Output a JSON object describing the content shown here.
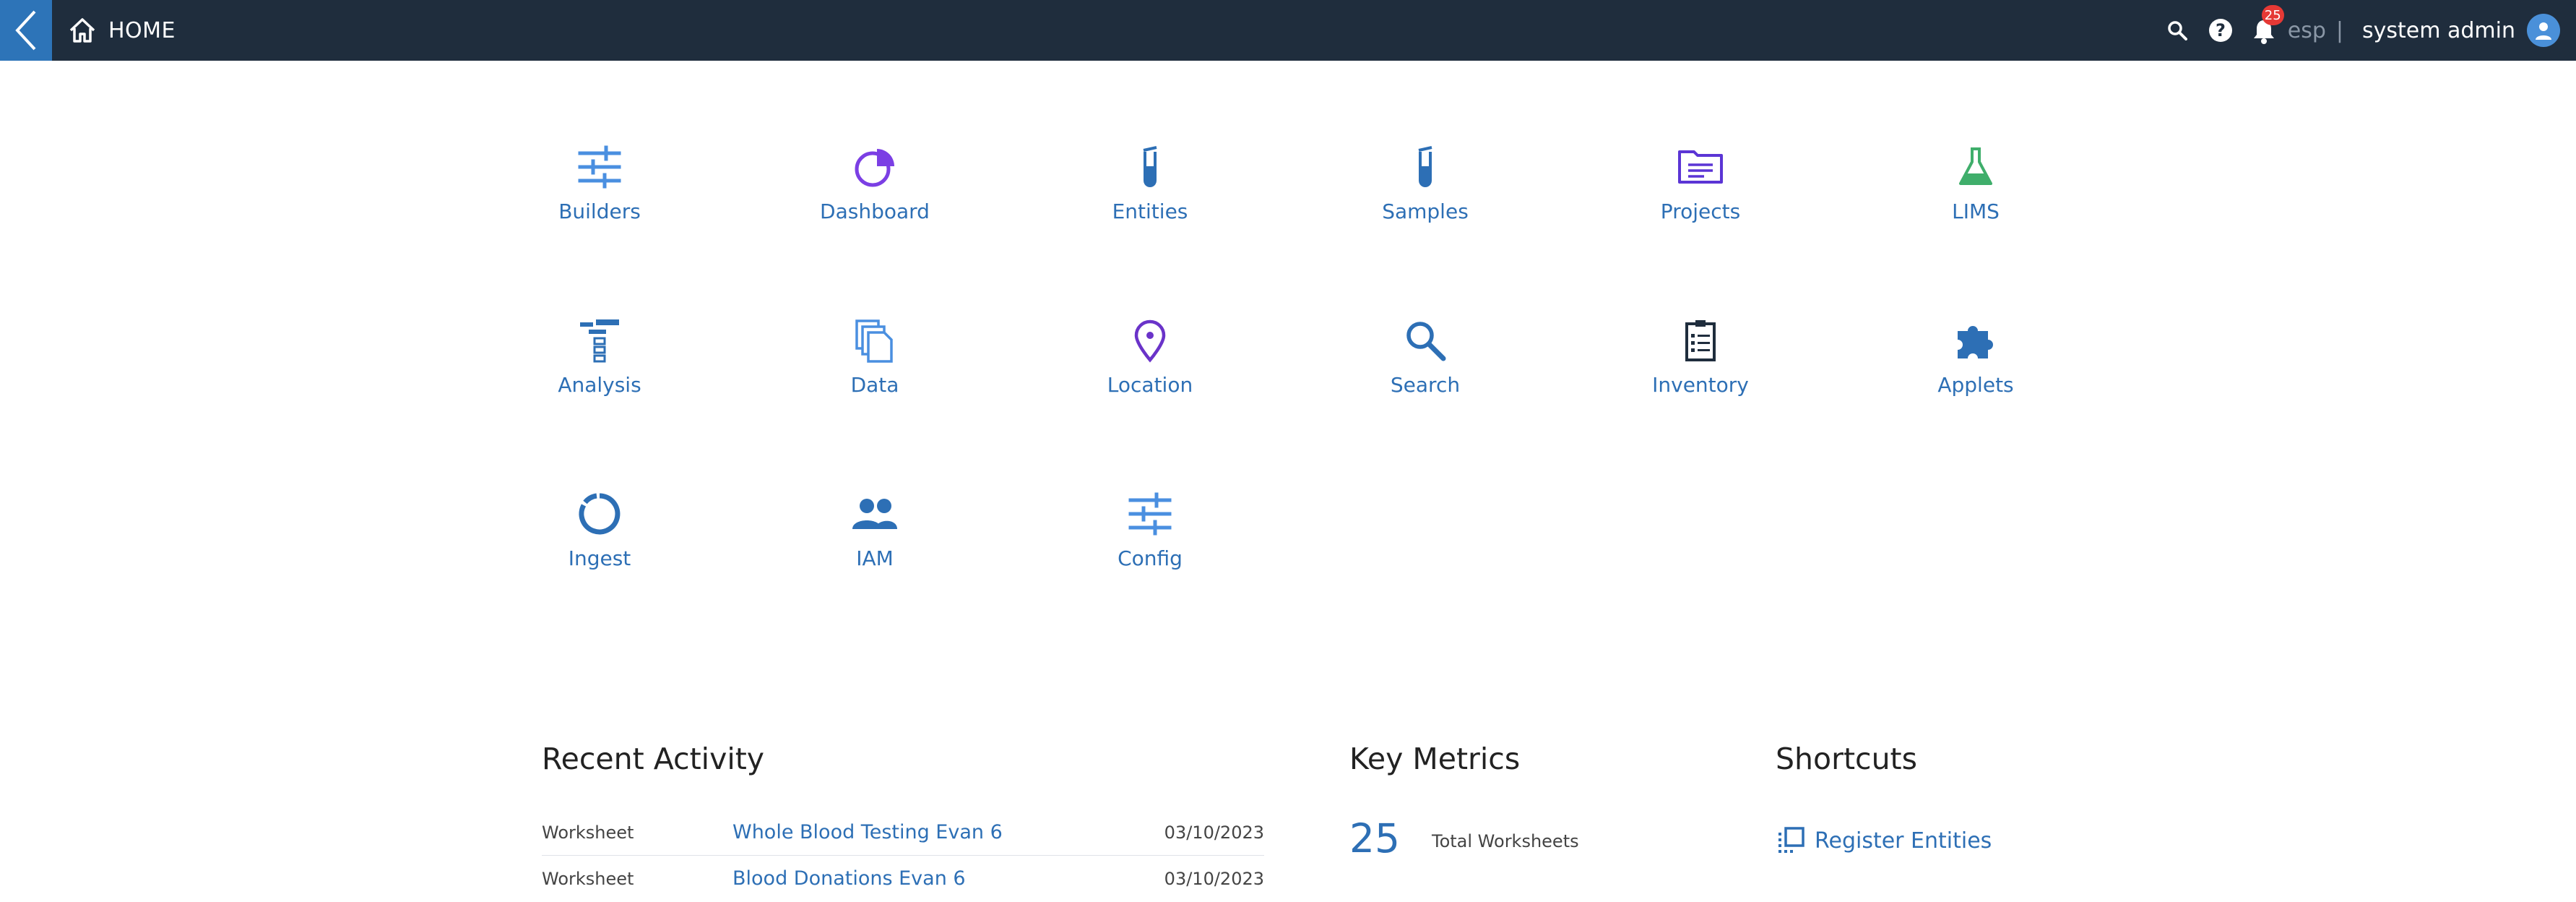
{
  "header": {
    "title": "HOME",
    "notification_count": "25",
    "tenant": "esp",
    "separator": "|",
    "user": "system admin"
  },
  "apps": [
    {
      "label": "Builders",
      "icon": "sliders-icon"
    },
    {
      "label": "Dashboard",
      "icon": "pie-chart-icon"
    },
    {
      "label": "Entities",
      "icon": "test-tube-icon"
    },
    {
      "label": "Samples",
      "icon": "test-tube-icon"
    },
    {
      "label": "Projects",
      "icon": "folder-icon"
    },
    {
      "label": "LIMS",
      "icon": "flask-icon"
    },
    {
      "label": "Analysis",
      "icon": "pipeline-icon"
    },
    {
      "label": "Data",
      "icon": "files-icon"
    },
    {
      "label": "Location",
      "icon": "map-pin-icon"
    },
    {
      "label": "Search",
      "icon": "search-icon"
    },
    {
      "label": "Inventory",
      "icon": "clipboard-icon"
    },
    {
      "label": "Applets",
      "icon": "puzzle-icon"
    },
    {
      "label": "Ingest",
      "icon": "ring-icon"
    },
    {
      "label": "IAM",
      "icon": "users-icon"
    },
    {
      "label": "Config",
      "icon": "sliders-icon"
    }
  ],
  "recent_activity": {
    "title": "Recent Activity",
    "rows": [
      {
        "type": "Worksheet",
        "name": "Whole Blood Testing Evan 6",
        "date": "03/10/2023"
      },
      {
        "type": "Worksheet",
        "name": "Blood Donations Evan 6",
        "date": "03/10/2023"
      }
    ]
  },
  "key_metrics": {
    "title": "Key Metrics",
    "value": "25",
    "label": "Total Worksheets"
  },
  "shortcuts": {
    "title": "Shortcuts",
    "items": [
      {
        "label": "Register Entities",
        "icon": "register-icon"
      }
    ]
  },
  "colors": {
    "topbar": "#1f2d3d",
    "accent": "#2d74b8",
    "link": "#2d6fb5",
    "purple": "#7b3fe4",
    "green": "#3fae6b"
  }
}
